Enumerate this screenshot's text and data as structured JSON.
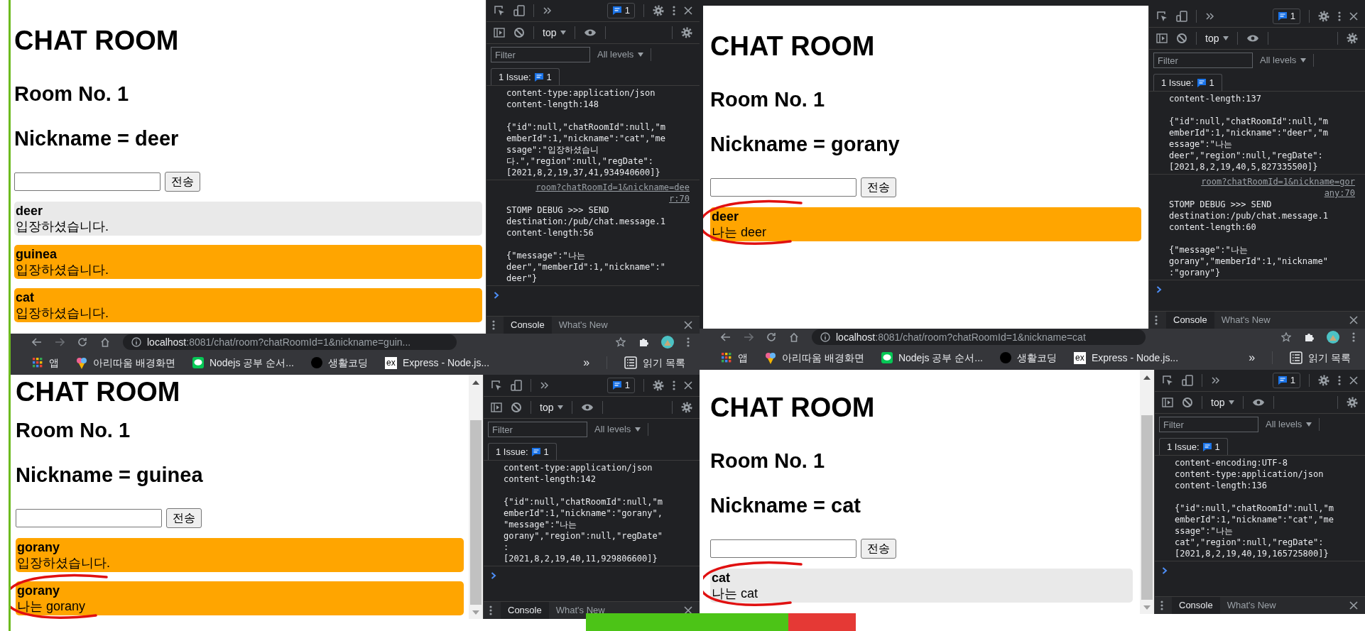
{
  "windows": [
    {
      "page": {
        "title": "CHAT ROOM",
        "room": "Room No. 1",
        "nickname": "Nickname = deer",
        "send_button": "전송",
        "messages": [
          {
            "sender": "deer",
            "text": "입장하셨습니다.",
            "color": "#e9e9e9",
            "circled": false
          },
          {
            "sender": "guinea",
            "text": "입장하셨습니다.",
            "color": "#ffa500",
            "circled": false
          },
          {
            "sender": "cat",
            "text": "입장하셨습니다.",
            "color": "#ffa500",
            "circled": false
          }
        ]
      },
      "devtools": {
        "issues_badge": "1",
        "context": "top",
        "filter_placeholder": "Filter",
        "levels": "All levels",
        "issues_label": "1 Issue:",
        "issues_count": "1",
        "log": [
          {
            "blocks": [
              [
                "content-type:application/json",
                "content-length:148"
              ],
              [
                "{\"id\":null,\"chatRoomId\":null,\"m",
                "emberId\":1,\"nickname\":\"cat\",\"me",
                "ssage\":\"입장하셨습니",
                "다.\",\"region\":null,\"regDate\":",
                "[2021,8,2,19,37,41,934940600]}"
              ]
            ]
          },
          {
            "source": [
              "room?chatRoomId=1&nickname=dee",
              "r:70"
            ],
            "blocks": [
              [
                "STOMP DEBUG >>> SEND",
                "destination:/pub/chat.message.1",
                "content-length:56"
              ],
              [
                "{\"message\":\"나는",
                "deer\",\"memberId\":1,\"nickname\":\"",
                "deer\"}"
              ]
            ]
          }
        ],
        "drawer_tabs": [
          {
            "label": "Console",
            "selected": true
          },
          {
            "label": "What's New",
            "selected": false
          }
        ]
      }
    },
    {
      "page": {
        "title": "CHAT ROOM",
        "room": "Room No. 1",
        "nickname": "Nickname = gorany",
        "send_button": "전송",
        "messages": [
          {
            "sender": "deer",
            "text": "나는 deer",
            "color": "#ffa500",
            "circled": true
          }
        ]
      },
      "devtools": {
        "issues_badge": "1",
        "context": "top",
        "filter_placeholder": "Filter",
        "levels": "All levels",
        "issues_label": "1 Issue:",
        "issues_count": "1",
        "log": [
          {
            "blocks": [
              [
                "content-length:137"
              ],
              [
                "{\"id\":null,\"chatRoomId\":null,\"m",
                "emberId\":1,\"nickname\":\"deer\",\"m",
                "essage\":\"나는",
                "deer\",\"region\":null,\"regDate\":",
                "[2021,8,2,19,40,5,827335500]}"
              ]
            ]
          },
          {
            "source": [
              "room?chatRoomId=1&nickname=gor",
              "any:70"
            ],
            "blocks": [
              [
                "STOMP DEBUG >>> SEND",
                "destination:/pub/chat.message.1",
                "content-length:60"
              ],
              [
                "{\"message\":\"나는",
                "gorany\",\"memberId\":1,\"nickname\"",
                ":\"gorany\"}"
              ]
            ]
          }
        ],
        "drawer_tabs": [
          {
            "label": "Console",
            "selected": true
          },
          {
            "label": "What's New",
            "selected": false
          }
        ]
      }
    },
    {
      "chrome": {
        "url_host": "localhost",
        "url_rest": ":8081/chat/room?chatRoomId=1&nickname=guin...",
        "bookmarks": [
          {
            "kind": "apps",
            "label": "앱"
          },
          {
            "kind": "icecream",
            "label": "아리따움 배경화면"
          },
          {
            "kind": "messenger",
            "label": "Nodejs 공부 순서..."
          },
          {
            "kind": "dot",
            "label": "생활코딩"
          },
          {
            "kind": "logo",
            "icon_text": "ex",
            "label": "Express - Node.js..."
          }
        ],
        "more": "»",
        "reading_list": "읽기 목록"
      },
      "page": {
        "title": "CHAT ROOM",
        "room": "Room No. 1",
        "nickname": "Nickname = guinea",
        "send_button": "전송",
        "messages": [
          {
            "sender": "gorany",
            "text": "입장하셨습니다.",
            "color": "#ffa500",
            "circled": false
          },
          {
            "sender": "gorany",
            "text": "나는 gorany",
            "color": "#ffa500",
            "circled": true
          }
        ]
      },
      "devtools": {
        "issues_badge": "1",
        "context": "top",
        "filter_placeholder": "Filter",
        "levels": "All levels",
        "issues_label": "1 Issue:",
        "issues_count": "1",
        "log": [
          {
            "blocks": [
              [
                "content-type:application/json",
                "content-length:142"
              ],
              [
                "{\"id\":null,\"chatRoomId\":null,\"m",
                "emberId\":1,\"nickname\":\"gorany\",",
                "\"message\":\"나는",
                "gorany\",\"region\":null,\"regDate\"",
                ":",
                "[2021,8,2,19,40,11,929806600]}"
              ]
            ]
          }
        ],
        "drawer_tabs": [
          {
            "label": "Console",
            "selected": true
          },
          {
            "label": "What's New",
            "selected": false
          }
        ]
      }
    },
    {
      "chrome": {
        "url_host": "localhost",
        "url_rest": ":8081/chat/room?chatRoomId=1&nickname=cat",
        "bookmarks": [
          {
            "kind": "apps",
            "label": "앱"
          },
          {
            "kind": "icecream",
            "label": "아리따움 배경화면"
          },
          {
            "kind": "messenger",
            "label": "Nodejs 공부 순서..."
          },
          {
            "kind": "dot",
            "label": "생활코딩"
          },
          {
            "kind": "logo",
            "icon_text": "ex",
            "label": "Express - Node.js..."
          }
        ],
        "more": "»",
        "reading_list": "읽기 목록"
      },
      "page": {
        "title": "CHAT ROOM",
        "room": "Room No. 1",
        "nickname": "Nickname = cat",
        "send_button": "전송",
        "messages": [
          {
            "sender": "cat",
            "text": "나는 cat",
            "color": "#e9e9e9",
            "circled": true
          }
        ]
      },
      "devtools": {
        "issues_badge": "1",
        "context": "top",
        "filter_placeholder": "Filter",
        "levels": "All levels",
        "issues_label": "1 Issue:",
        "issues_count": "1",
        "log": [
          {
            "blocks": [
              [
                "content-encoding:UTF-8",
                "content-type:application/json",
                "content-length:136"
              ],
              [
                "{\"id\":null,\"chatRoomId\":null,\"m",
                "emberId\":1,\"nickname\":\"cat\",\"me",
                "ssage\":\"나는",
                "cat\",\"region\":null,\"regDate\":",
                "[2021,8,2,19,40,19,165725800]}"
              ]
            ]
          }
        ],
        "drawer_tabs": [
          {
            "label": "Console",
            "selected": true
          },
          {
            "label": "What's New",
            "selected": false
          }
        ]
      }
    }
  ]
}
